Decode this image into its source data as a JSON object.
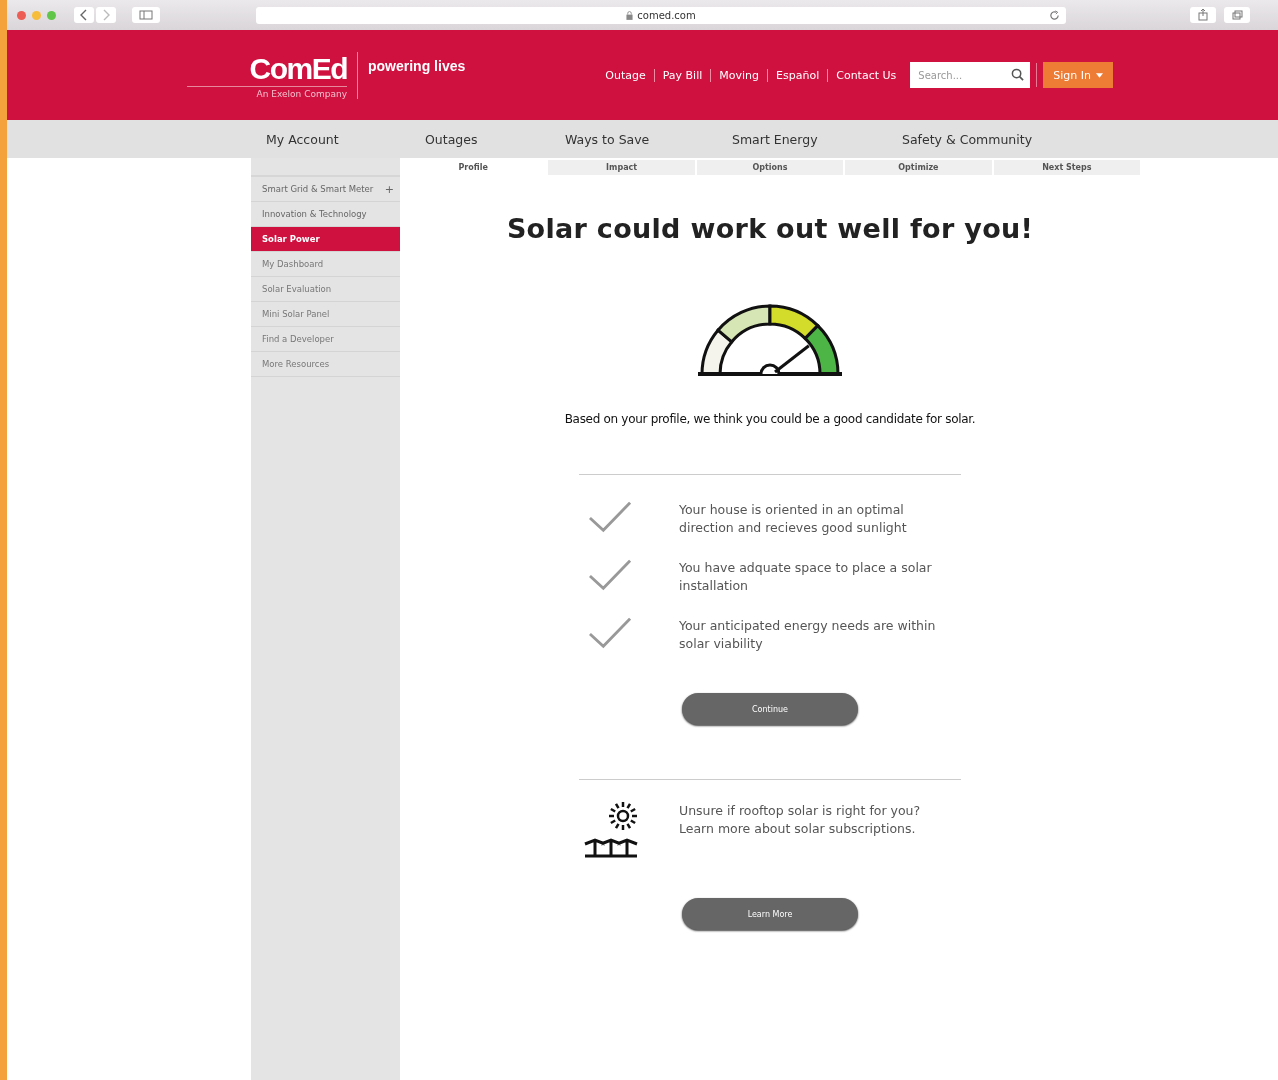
{
  "browser": {
    "url": "comed.com"
  },
  "header": {
    "logo": "ComEd",
    "logo_sub": "An Exelon Company",
    "tagline": "powering lives",
    "links": [
      "Outage",
      "Pay Bill",
      "Moving",
      "Español",
      "Contact Us"
    ],
    "search": {
      "placeholder": "Search..."
    },
    "sign_in": "Sign In"
  },
  "nav": [
    "My Account",
    "Outages",
    "Ways to Save",
    "Smart Energy",
    "Safety & Community"
  ],
  "sidebar": {
    "items": [
      {
        "label": "Smart Grid & Smart Meter",
        "expander": "+",
        "selected": false,
        "kind": "section"
      },
      {
        "label": "Innovation & Technology",
        "selected": false,
        "kind": "section"
      },
      {
        "label": "Solar Power",
        "selected": true,
        "kind": "page"
      },
      {
        "label": "My Dashboard",
        "selected": false,
        "kind": "page"
      },
      {
        "label": "Solar Evaluation",
        "selected": false,
        "kind": "page"
      },
      {
        "label": "Mini Solar Panel",
        "selected": false,
        "kind": "page"
      },
      {
        "label": "Find a Developer",
        "selected": false,
        "kind": "page"
      },
      {
        "label": "More Resources",
        "selected": false,
        "kind": "page"
      }
    ]
  },
  "steps": [
    {
      "label": "Profile",
      "selected": true
    },
    {
      "label": "Impact",
      "selected": false
    },
    {
      "label": "Options",
      "selected": false
    },
    {
      "label": "Optimize",
      "selected": false
    },
    {
      "label": "Next Steps",
      "selected": false
    }
  ],
  "main": {
    "title": "Solar could work out well for you!",
    "summary": "Based on your profile, we think you could be a good candidate for solar.",
    "criteria": [
      {
        "text": "Your house is oriented in an optimal direction and recieves good sunlight",
        "checked": true
      },
      {
        "text": "You have adquate space to place a solar installation",
        "checked": true
      },
      {
        "text": "Your anticipated energy needs are within solar viability",
        "checked": true
      }
    ],
    "continue": "Continue",
    "promo": [
      "Unsure if rooftop solar is right for you?",
      "Learn more about solar subscriptions."
    ],
    "learn_more": "Learn More"
  }
}
